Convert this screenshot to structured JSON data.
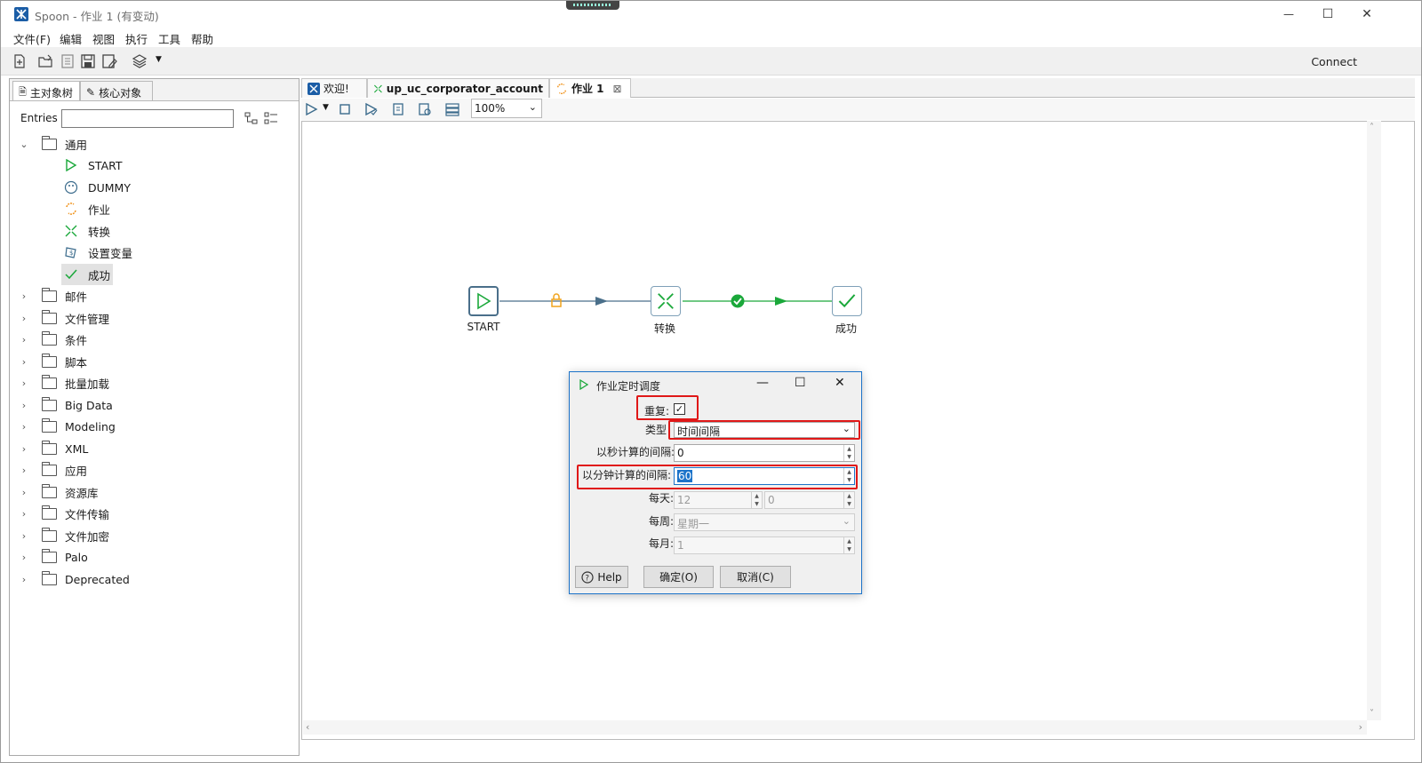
{
  "window": {
    "title": "Spoon - 作业 1 (有变动)",
    "controls": {
      "minimize": "—",
      "maximize": "☐",
      "close": "✕"
    }
  },
  "menu": [
    "文件(F)",
    "编辑",
    "视图",
    "执行",
    "工具",
    "帮助"
  ],
  "toolbar": {
    "connect_label": "Connect"
  },
  "left_panel": {
    "tabs": [
      "主对象树",
      "核心对象"
    ],
    "entries_label": "Entries",
    "entries_value": "",
    "tree": {
      "root_folder": "通用",
      "children": [
        "START",
        "DUMMY",
        "作业",
        "转换",
        "设置变量",
        "成功"
      ],
      "selected": "成功",
      "folders": [
        "邮件",
        "文件管理",
        "条件",
        "脚本",
        "批量加载",
        "Big Data",
        "Modeling",
        "XML",
        "应用",
        "资源库",
        "文件传输",
        "文件加密",
        "Palo",
        "Deprecated"
      ]
    }
  },
  "tabs": {
    "welcome": "欢迎!",
    "transformation": "up_uc_corporator_account",
    "job": "作业 1",
    "job_close": "⊠"
  },
  "canvas_toolbar": {
    "zoom": "100%"
  },
  "flow": {
    "nodes": [
      "START",
      "转换",
      "成功"
    ]
  },
  "dialog": {
    "title": "作业定时调度",
    "repeat_label": "重复:",
    "repeat_checked": true,
    "type_label": "类型",
    "type_value": "时间间隔",
    "seconds_label": "以秒计算的间隔:",
    "seconds_value": "0",
    "minutes_label": "以分钟计算的间隔:",
    "minutes_value": "60",
    "daily_label": "每天:",
    "daily_hour": "12",
    "daily_minute": "0",
    "weekly_label": "每周:",
    "weekly_value": "星期一",
    "monthly_label": "每月:",
    "monthly_value": "1",
    "help_label": "Help",
    "ok_label": "确定(O)",
    "cancel_label": "取消(C)"
  }
}
